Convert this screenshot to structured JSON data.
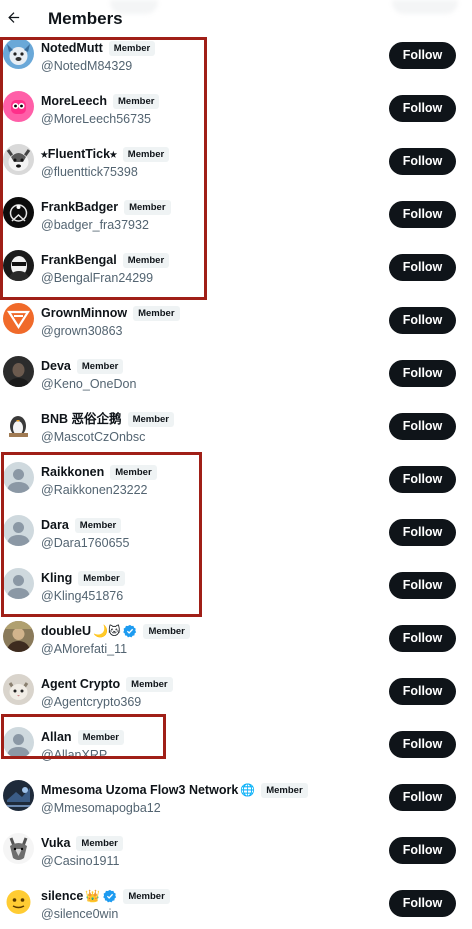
{
  "header": {
    "title": "Members",
    "back_icon": "arrow-left-icon"
  },
  "badge_label": "Member",
  "follow_label": "Follow",
  "colors": {
    "follow_bg": "#0f1419",
    "highlight_border": "#a01f17",
    "verified": "#1d9bf0",
    "handle": "#536471"
  },
  "members": [
    {
      "name": "NotedMutt",
      "handle": "@NotedM84329",
      "avatar": "blue-dog-avatar"
    },
    {
      "name": "MoreLeech",
      "handle": "@MoreLeech56735",
      "avatar": "pink-creature-avatar"
    },
    {
      "name": "⭑FluentTick⭑",
      "handle": "@fluenttick75398",
      "avatar": "husky-avatar"
    },
    {
      "name": "FrankBadger",
      "handle": "@badger_fra37932",
      "avatar": "badger-avatar"
    },
    {
      "name": "FrankBengal",
      "handle": "@BengalFran24299",
      "avatar": "masked-face-avatar"
    },
    {
      "name": "GrownMinnow",
      "handle": "@grown30863",
      "avatar": "orange-logo-avatar"
    },
    {
      "name": "Deva",
      "handle": "@Keno_OneDon",
      "avatar": "dark-portrait-avatar"
    },
    {
      "name": "BNB 恶俗企鹅",
      "handle": "@MascotCzOnbsc",
      "avatar": "penguin-avatar"
    },
    {
      "name": "Raikkonen",
      "handle": "@Raikkonen23222",
      "avatar": "default-avatar"
    },
    {
      "name": "Dara",
      "handle": "@Dara1760655",
      "avatar": "default-avatar"
    },
    {
      "name": "Kling",
      "handle": "@Kling451876",
      "avatar": "default-avatar"
    },
    {
      "name": "doubleU",
      "emoji": "🌙🐱",
      "verified": true,
      "handle": "@AMorefati_11",
      "avatar": "photo-avatar"
    },
    {
      "name": "Agent Crypto",
      "handle": "@Agentcrypto369",
      "avatar": "cat-avatar"
    },
    {
      "name": "Allan",
      "handle": "@AllanXRP",
      "avatar": "default-avatar"
    },
    {
      "name": "Mmesoma Uzoma Flow3 Network",
      "emoji": "🌐",
      "handle": "@Mmesomapogba12",
      "avatar": "abstract-avatar"
    },
    {
      "name": "Vuka",
      "handle": "@Casino1911",
      "avatar": "wolf-avatar"
    },
    {
      "name": "silence",
      "emoji": "👑",
      "verified": true,
      "handle": "@silence0win",
      "avatar": "emoji-face-avatar"
    }
  ]
}
